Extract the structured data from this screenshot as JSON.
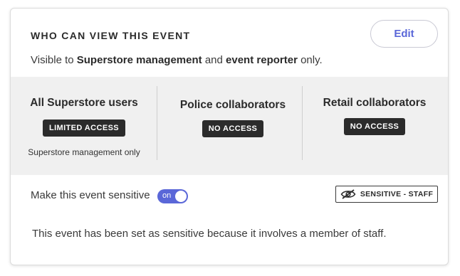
{
  "header": {
    "title": "WHO CAN VIEW THIS EVENT",
    "edit_label": "Edit"
  },
  "visibility": {
    "prefix": "Visible to ",
    "group1": "Superstore management",
    "middle": " and ",
    "group2": "event reporter",
    "suffix": " only."
  },
  "access_columns": [
    {
      "heading": "All Superstore users",
      "badge": "LIMITED ACCESS",
      "note": "Superstore management only"
    },
    {
      "heading": "Police collaborators",
      "badge": "NO ACCESS"
    },
    {
      "heading": "Retail collaborators",
      "badge": "NO ACCESS"
    }
  ],
  "sensitivity": {
    "label": "Make this event sensitive",
    "toggle_text": "on",
    "toggle_state": true,
    "badge_icon": "eye-slash-icon",
    "badge_label": "SENSITIVE - STAFF",
    "note": "This event has been set as sensitive because it involves a member of staff."
  },
  "colors": {
    "accent": "#5a67d8",
    "badge_bg": "#2b2b2b",
    "panel_bg": "#f0f0f0"
  }
}
